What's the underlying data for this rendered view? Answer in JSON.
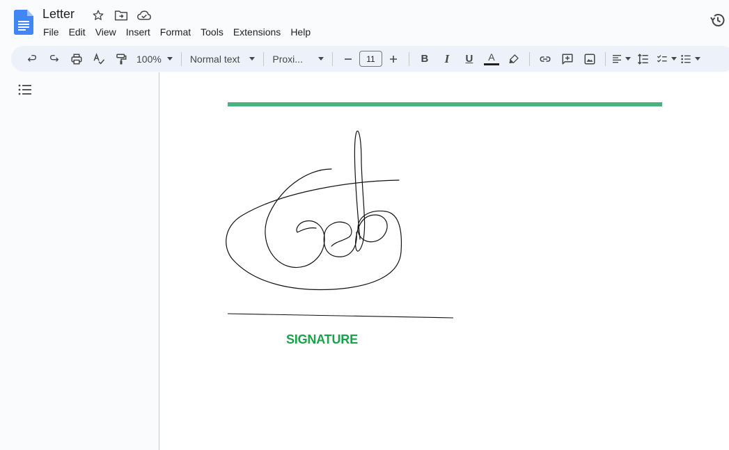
{
  "document": {
    "title": "Letter",
    "menu": [
      "File",
      "Edit",
      "View",
      "Insert",
      "Format",
      "Tools",
      "Extensions",
      "Help"
    ]
  },
  "toolbar": {
    "zoom": "100%",
    "style": "Normal text",
    "font": "Proxi...",
    "font_size": "11",
    "bold": "B",
    "italic": "I",
    "underline": "U",
    "text_color": "A",
    "text_color_bar": "#1f1f1f"
  },
  "content": {
    "rule_color": "#4ab27f",
    "signature_label": "SIGNATURE",
    "signature_label_color": "#1aa24a"
  },
  "icons": [
    "docs-logo-icon",
    "star-icon",
    "move-folder-icon",
    "cloud-saved-icon",
    "history-icon",
    "undo-icon",
    "redo-icon",
    "print-icon",
    "spellcheck-icon",
    "paint-format-icon",
    "minus-icon",
    "plus-icon",
    "highlighter-icon",
    "link-icon",
    "add-comment-icon",
    "image-icon",
    "align-left-icon",
    "line-spacing-icon",
    "checklist-icon",
    "bulleted-list-icon",
    "outline-icon"
  ]
}
